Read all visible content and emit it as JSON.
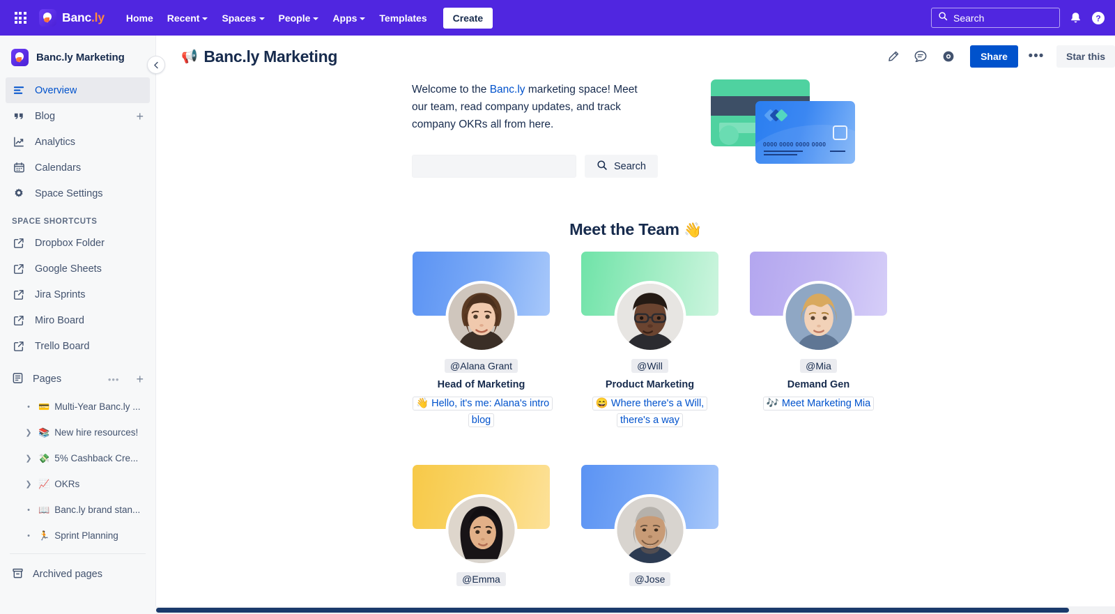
{
  "topnav": {
    "app_switcher": "app-switcher",
    "brand_main": "Banc",
    "brand_suffix": ".ly",
    "items": [
      {
        "label": "Home",
        "has_caret": false
      },
      {
        "label": "Recent",
        "has_caret": true
      },
      {
        "label": "Spaces",
        "has_caret": true
      },
      {
        "label": "People",
        "has_caret": true
      },
      {
        "label": "Apps",
        "has_caret": true
      },
      {
        "label": "Templates",
        "has_caret": false
      }
    ],
    "create_label": "Create",
    "search_placeholder": "Search",
    "search_value": "",
    "notifications_icon": "bell-icon",
    "help_icon": "help-icon",
    "background": "#5026e0"
  },
  "sidebar": {
    "space_name": "Banc.ly Marketing",
    "collapse_label": "‹",
    "nav": [
      {
        "label": "Overview",
        "icon": "overview-icon",
        "active": true,
        "plus": false
      },
      {
        "label": "Blog",
        "icon": "blog-quote-icon",
        "active": false,
        "plus": true
      },
      {
        "label": "Analytics",
        "icon": "analytics-chart-icon",
        "active": false,
        "plus": false
      },
      {
        "label": "Calendars",
        "icon": "calendar-icon",
        "active": false,
        "plus": false
      },
      {
        "label": "Space Settings",
        "icon": "gear-icon",
        "active": false,
        "plus": false
      }
    ],
    "shortcuts_title": "SPACE SHORTCUTS",
    "shortcuts": [
      {
        "label": "Dropbox Folder",
        "icon": "external-link-icon"
      },
      {
        "label": "Google Sheets",
        "icon": "external-link-icon"
      },
      {
        "label": "Jira Sprints",
        "icon": "external-link-icon"
      },
      {
        "label": "Miro Board",
        "icon": "external-link-icon"
      },
      {
        "label": "Trello Board",
        "icon": "external-link-icon"
      }
    ],
    "pages_label": "Pages",
    "pages_more": "•••",
    "pages_add": "+",
    "tree": [
      {
        "label": "Multi-Year Banc.ly ...",
        "emoji": "💳",
        "expandable": false
      },
      {
        "label": "New hire resources!",
        "emoji": "📚",
        "expandable": true
      },
      {
        "label": "5% Cashback Cre...",
        "emoji": "💸",
        "expandable": true
      },
      {
        "label": "OKRs",
        "emoji": "📈",
        "expandable": true
      },
      {
        "label": "Banc.ly brand stan...",
        "emoji": "📖",
        "expandable": false
      },
      {
        "label": "Sprint Planning",
        "emoji": "🏃",
        "expandable": false
      }
    ],
    "archived_label": "Archived pages",
    "archived_icon": "archive-box-icon"
  },
  "page_header": {
    "emoji": "📢",
    "title": "Banc.ly Marketing",
    "edit_icon": "pencil-icon",
    "comment_icon": "comment-icon",
    "watch_icon": "eye-icon",
    "share_label": "Share",
    "more_label": "•••",
    "star_label": "Star this"
  },
  "content": {
    "intro": {
      "before": "Welcome to the ",
      "link": "Banc.ly",
      "after": " marketing space! Meet our team, read company updates, and track company OKRs all from here."
    },
    "search": {
      "value": "",
      "placeholder": "",
      "button_label": "Search",
      "button_icon": "search-icon"
    },
    "illustration": {
      "name": "credit-cards-illustration",
      "card_number": "0000 0000 0000 0000",
      "green_color": "#4fd2a0",
      "blue_color": "#2a7ef0"
    },
    "team_heading": "Meet the Team",
    "team_heading_emoji": "👋",
    "team": [
      {
        "mention": "@Alana Grant",
        "role": "Head of Marketing",
        "link_emoji": "👋",
        "link_text": "Hello, it's me: Alana's intro blog",
        "bg": "linear-gradient(100deg,#5b93f3 0%,#7cabf7 55%,#a8c8fa 100%)"
      },
      {
        "mention": "@Will",
        "role": "Product Marketing",
        "link_emoji": "😄",
        "link_text": "Where there's a Will, there's a way",
        "bg": "linear-gradient(100deg,#6fe3a8 0%,#a8eec8 60%,#cdf5df 100%)"
      },
      {
        "mention": "@Mia",
        "role": "Demand Gen",
        "link_emoji": "🎶",
        "link_text": "Meet Marketing Mia",
        "bg": "linear-gradient(100deg,#b3a6ef 0%,#c3b8f3 55%,#d6cef8 100%)"
      },
      {
        "mention": "@Emma",
        "role": "",
        "link_emoji": "",
        "link_text": "",
        "bg": "linear-gradient(100deg,#f7c948 0%,#fad66d 55%,#fde199 100%)"
      },
      {
        "mention": "@Jose",
        "role": "",
        "link_emoji": "",
        "link_text": "",
        "bg": "linear-gradient(100deg,#5b93f3 0%,#7cabf7 55%,#a8c8fa 100%)"
      }
    ]
  },
  "colors": {
    "brand_purple": "#5026e0",
    "link_blue": "#0052cc",
    "text": "#172b4d",
    "sidebar_bg": "#f7f8f9"
  }
}
